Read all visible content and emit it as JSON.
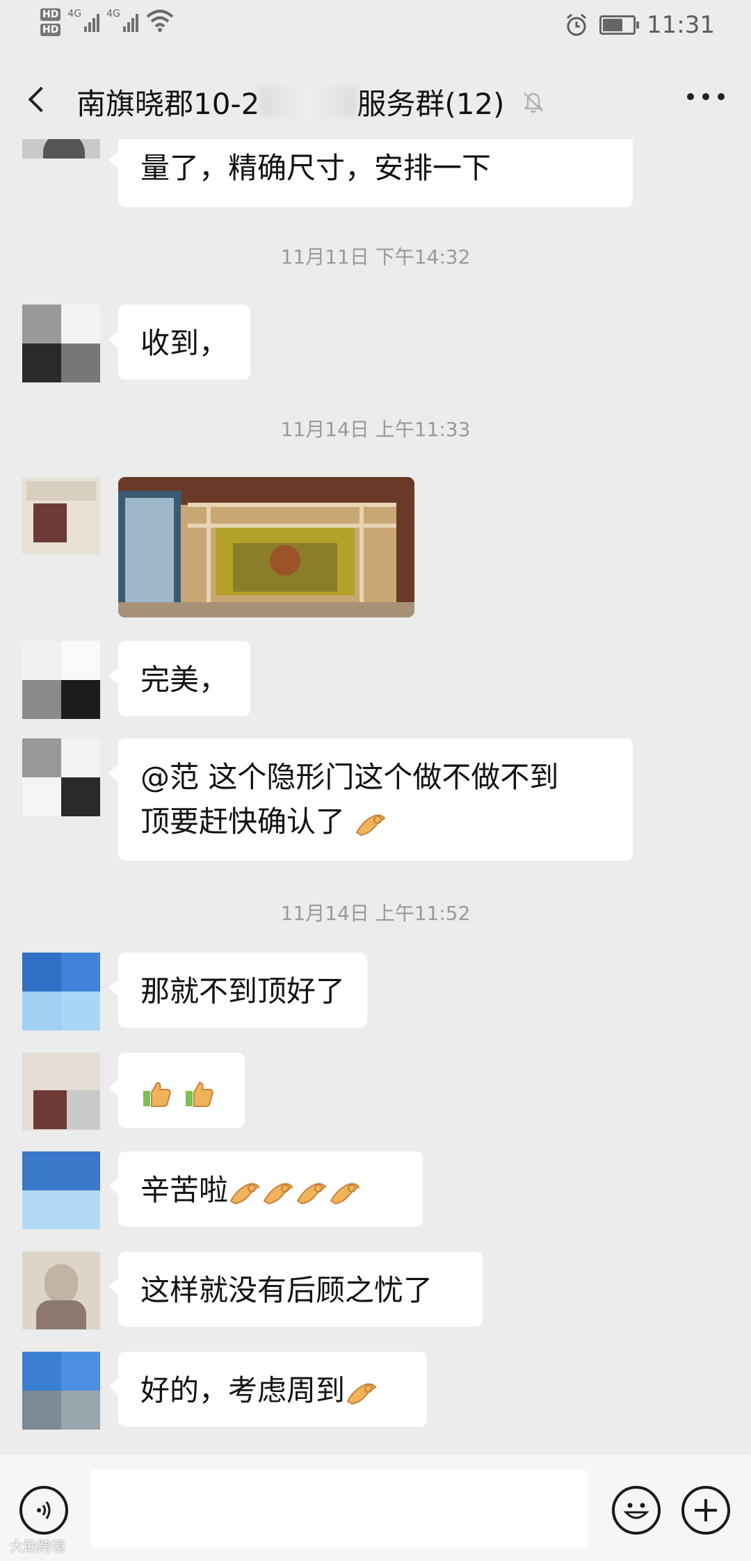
{
  "status": {
    "time": "11:31",
    "hd1": "HD",
    "hd2": "HD",
    "net1": "4G",
    "net2": "4G"
  },
  "header": {
    "title_prefix": "南旗晓郡10-2",
    "title_suffix": "服务群(12)"
  },
  "messages": {
    "m0": "量了，精确尺寸，安排一下",
    "t1": "11月11日 下午14:32",
    "m1": "收到，",
    "t2": "11月14日 上午11:33",
    "m3": "完美，",
    "m4a": "@范   这个隐形门这个做不做不到",
    "m4b": "顶要赶快确认了",
    "t3": "11月14日 上午11:52",
    "m5": "那就不到顶好了",
    "m7": "辛苦啦",
    "m8": "这样就没有后顾之忧了",
    "m9": "好的，考虑周到"
  },
  "icons": {
    "back": "chevron-left-icon",
    "mute": "bell-off-icon",
    "more": "more-dots-icon",
    "voice": "voice-icon",
    "emoji": "emoji-icon",
    "plus": "plus-icon",
    "ok_hand": "ok-hand-emoji",
    "thumbs_up": "thumbs-up-emoji"
  },
  "colors": {
    "background": "#ececec",
    "bubble": "#ffffff",
    "text": "#111111",
    "timestamp": "#999999"
  },
  "watermark": "大助跨境"
}
